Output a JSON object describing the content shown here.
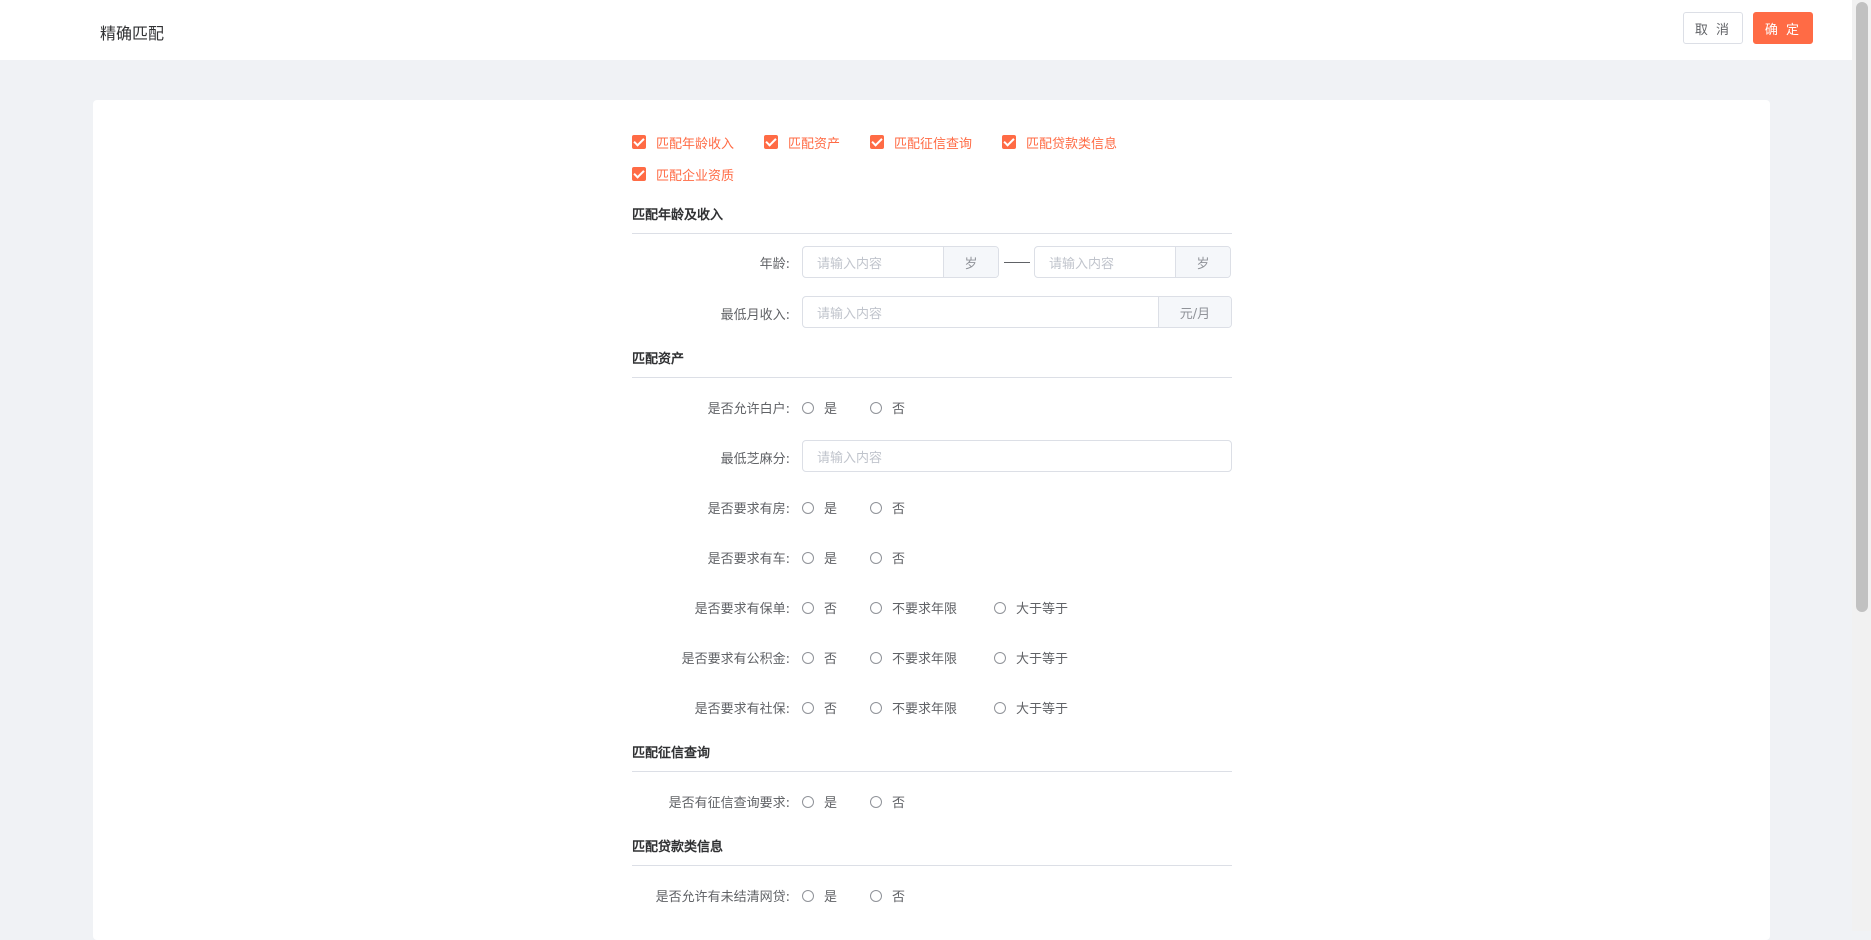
{
  "header": {
    "title": "精确匹配",
    "cancel_label": "取 消",
    "confirm_label": "确 定"
  },
  "filters": [
    {
      "label": "匹配年龄收入",
      "checked": true
    },
    {
      "label": "匹配资产",
      "checked": true
    },
    {
      "label": "匹配征信查询",
      "checked": true
    },
    {
      "label": "匹配贷款类信息",
      "checked": true
    },
    {
      "label": "匹配企业资质",
      "checked": true
    }
  ],
  "sections": {
    "age_income": "匹配年龄及收入",
    "assets": "匹配资产",
    "credit": "匹配征信查询",
    "loan": "匹配贷款类信息"
  },
  "form": {
    "age_label": "年龄:",
    "age_min_placeholder": "请输入内容",
    "age_max_placeholder": "请输入内容",
    "age_unit": "岁",
    "income_label": "最低月收入:",
    "income_placeholder": "请输入内容",
    "income_unit": "元/月",
    "white_label": "是否允许白户:",
    "sesame_label": "最低芝麻分:",
    "sesame_placeholder": "请输入内容",
    "house_label": "是否要求有房:",
    "car_label": "是否要求有车:",
    "policy_label": "是否要求有保单:",
    "fund_label": "是否要求有公积金:",
    "social_label": "是否要求有社保:",
    "credit_label": "是否有征信查询要求:",
    "netloan_label": "是否允许有未结清网贷:",
    "yes": "是",
    "no": "否",
    "no_limit": "不要求年限",
    "gte": "大于等于"
  },
  "colors": {
    "accent": "#ff6b45",
    "background": "#f0f2f5"
  }
}
